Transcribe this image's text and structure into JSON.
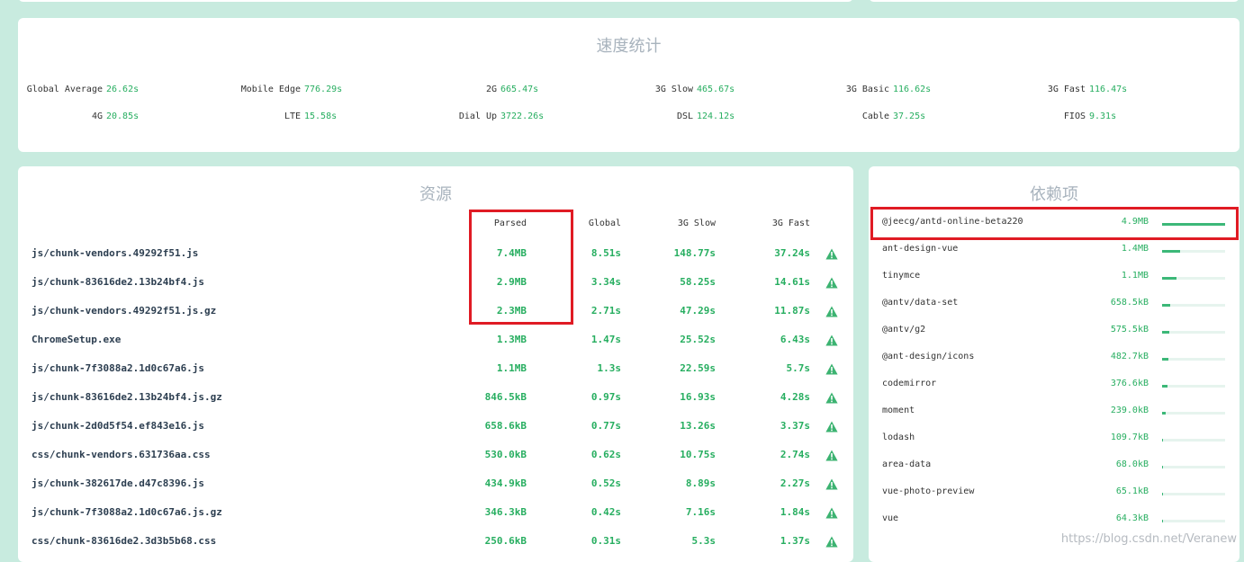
{
  "speed": {
    "title": "速度统计",
    "items": [
      {
        "name": "Global Average",
        "value": "26.62s"
      },
      {
        "name": "Mobile Edge",
        "value": "776.29s"
      },
      {
        "name": "2G",
        "value": "665.47s"
      },
      {
        "name": "3G Slow",
        "value": "465.67s"
      },
      {
        "name": "3G Basic",
        "value": "116.62s"
      },
      {
        "name": "3G Fast",
        "value": "116.47s"
      },
      {
        "name": "4G",
        "value": "20.85s"
      },
      {
        "name": "LTE",
        "value": "15.58s"
      },
      {
        "name": "Dial Up",
        "value": "3722.26s"
      },
      {
        "name": "DSL",
        "value": "124.12s"
      },
      {
        "name": "Cable",
        "value": "37.25s"
      },
      {
        "name": "FIOS",
        "value": "9.31s"
      }
    ]
  },
  "assets": {
    "title": "资源",
    "columns": {
      "parsed": "Parsed",
      "global": "Global",
      "slow": "3G Slow",
      "fast": "3G Fast"
    },
    "warning_icon": "warning-triangle-icon",
    "rows": [
      {
        "name": "js/chunk-vendors.49292f51.js",
        "parsed": "7.4MB",
        "global": "8.51s",
        "slow": "148.77s",
        "fast": "37.24s"
      },
      {
        "name": "js/chunk-83616de2.13b24bf4.js",
        "parsed": "2.9MB",
        "global": "3.34s",
        "slow": "58.25s",
        "fast": "14.61s"
      },
      {
        "name": "js/chunk-vendors.49292f51.js.gz",
        "parsed": "2.3MB",
        "global": "2.71s",
        "slow": "47.29s",
        "fast": "11.87s"
      },
      {
        "name": "ChromeSetup.exe",
        "parsed": "1.3MB",
        "global": "1.47s",
        "slow": "25.52s",
        "fast": "6.43s"
      },
      {
        "name": "js/chunk-7f3088a2.1d0c67a6.js",
        "parsed": "1.1MB",
        "global": "1.3s",
        "slow": "22.59s",
        "fast": "5.7s"
      },
      {
        "name": "js/chunk-83616de2.13b24bf4.js.gz",
        "parsed": "846.5kB",
        "global": "0.97s",
        "slow": "16.93s",
        "fast": "4.28s"
      },
      {
        "name": "js/chunk-2d0d5f54.ef843e16.js",
        "parsed": "658.6kB",
        "global": "0.77s",
        "slow": "13.26s",
        "fast": "3.37s"
      },
      {
        "name": "css/chunk-vendors.631736aa.css",
        "parsed": "530.0kB",
        "global": "0.62s",
        "slow": "10.75s",
        "fast": "2.74s"
      },
      {
        "name": "js/chunk-382617de.d47c8396.js",
        "parsed": "434.9kB",
        "global": "0.52s",
        "slow": "8.89s",
        "fast": "2.27s"
      },
      {
        "name": "js/chunk-7f3088a2.1d0c67a6.js.gz",
        "parsed": "346.3kB",
        "global": "0.42s",
        "slow": "7.16s",
        "fast": "1.84s"
      },
      {
        "name": "css/chunk-83616de2.3d3b5b68.css",
        "parsed": "250.6kB",
        "global": "0.31s",
        "slow": "5.3s",
        "fast": "1.37s"
      }
    ]
  },
  "deps": {
    "title": "依赖项",
    "rows": [
      {
        "name": "@jeecg/antd-online-beta220",
        "size": "4.9MB",
        "ratio": 1.0
      },
      {
        "name": "ant-design-vue",
        "size": "1.4MB",
        "ratio": 0.29
      },
      {
        "name": "tinymce",
        "size": "1.1MB",
        "ratio": 0.23
      },
      {
        "name": "@antv/data-set",
        "size": "658.5kB",
        "ratio": 0.13
      },
      {
        "name": "@antv/g2",
        "size": "575.5kB",
        "ratio": 0.12
      },
      {
        "name": "@ant-design/icons",
        "size": "482.7kB",
        "ratio": 0.1
      },
      {
        "name": "codemirror",
        "size": "376.6kB",
        "ratio": 0.08
      },
      {
        "name": "moment",
        "size": "239.0kB",
        "ratio": 0.05
      },
      {
        "name": "lodash",
        "size": "109.7kB",
        "ratio": 0.02
      },
      {
        "name": "area-data",
        "size": "68.0kB",
        "ratio": 0.014
      },
      {
        "name": "vue-photo-preview",
        "size": "65.1kB",
        "ratio": 0.013
      },
      {
        "name": "vue",
        "size": "64.3kB",
        "ratio": 0.013
      }
    ]
  },
  "watermark": "https://blog.csdn.net/Veranew",
  "colors": {
    "background": "#c8ebdf",
    "accent": "#27ae60",
    "highlight": "#e01b24",
    "title": "#a8b3bd"
  }
}
